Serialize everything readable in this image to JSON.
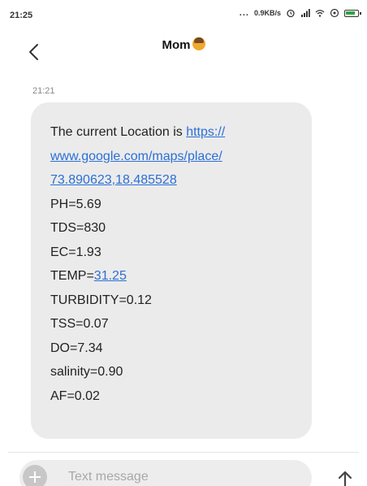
{
  "status_bar": {
    "time": "21:25",
    "dots": "...",
    "speed": "0.9KB/s"
  },
  "header": {
    "contact_name": "Mom"
  },
  "conversation": {
    "timestamp": "21:21",
    "message": {
      "location_prefix": "The current Location is ",
      "link_line_1": "https://",
      "link_line_2": "www.google.com/maps/place/",
      "link_line_3": "73.890623,18.485528",
      "ph": "PH=5.69",
      "tds": "TDS=830",
      "ec": "EC=1.93",
      "temp_prefix": "TEMP=",
      "temp_value": "31.25",
      "turbidity": "TURBIDITY=0.12",
      "tss": "TSS=0.07",
      "do": "DO=7.34",
      "salinity": "salinity=0.90",
      "af": "AF=0.02"
    }
  },
  "composer": {
    "placeholder": "Text message"
  },
  "icons": {
    "back": "back-chevron-icon",
    "add": "add-icon",
    "send": "send-arrow-icon",
    "wifi": "wifi-icon",
    "signal": "signal-icon",
    "battery": "battery-icon"
  }
}
